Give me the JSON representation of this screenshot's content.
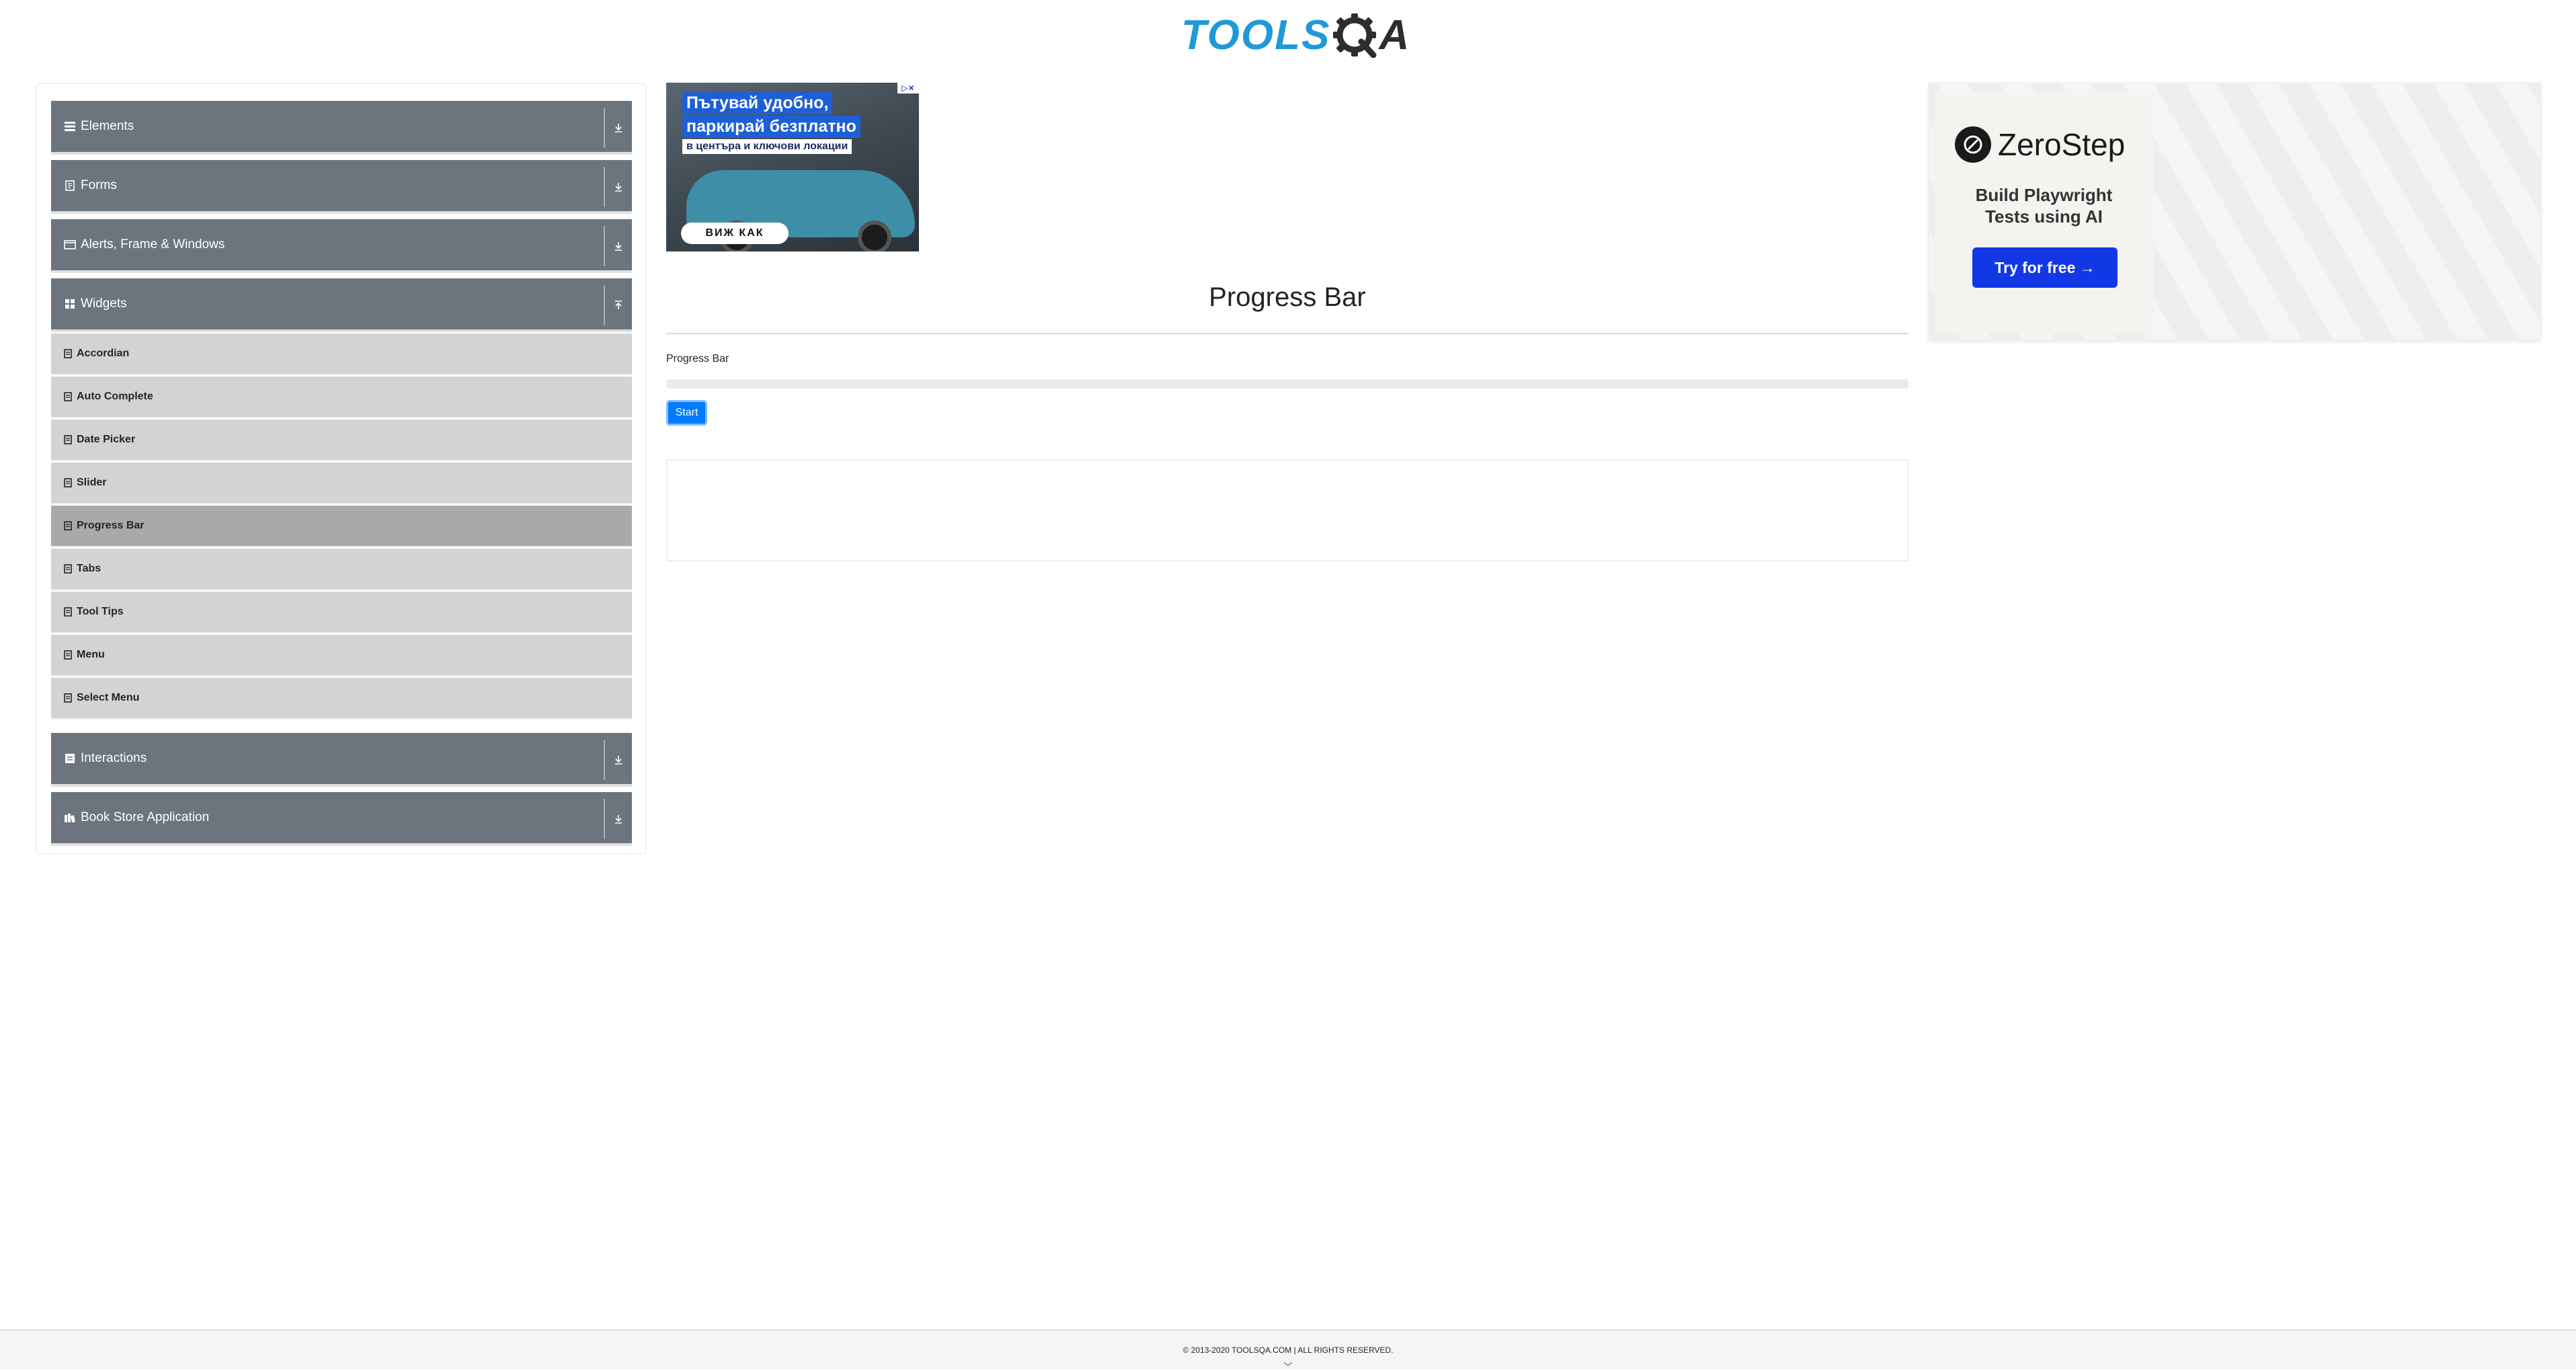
{
  "brand": {
    "logo_text_left": "TOOLS",
    "logo_text_right": "A"
  },
  "sidebar": {
    "groups": [
      {
        "label": "Elements",
        "icon": "menu-icon",
        "expanded": false
      },
      {
        "label": "Forms",
        "icon": "document-icon",
        "expanded": false
      },
      {
        "label": "Alerts, Frame & Windows",
        "icon": "window-icon",
        "expanded": false
      },
      {
        "label": "Widgets",
        "icon": "grid-icon",
        "expanded": true
      },
      {
        "label": "Interactions",
        "icon": "interaction-icon",
        "expanded": false
      },
      {
        "label": "Book Store Application",
        "icon": "books-icon",
        "expanded": false
      }
    ],
    "widget_items": [
      {
        "label": "Accordian",
        "active": false
      },
      {
        "label": "Auto Complete",
        "active": false
      },
      {
        "label": "Date Picker",
        "active": false
      },
      {
        "label": "Slider",
        "active": false
      },
      {
        "label": "Progress Bar",
        "active": true
      },
      {
        "label": "Tabs",
        "active": false
      },
      {
        "label": "Tool Tips",
        "active": false
      },
      {
        "label": "Menu",
        "active": false
      },
      {
        "label": "Select Menu",
        "active": false
      }
    ]
  },
  "ad_left": {
    "line1": "Пътувай удобно,",
    "line2": "паркирай безплатно",
    "line3": "в центъра и ключови локации",
    "cta": "ВИЖ КАК"
  },
  "main": {
    "title": "Progress Bar",
    "progress_label": "Progress Bar",
    "progress_value": 0,
    "start_button": "Start"
  },
  "ad_right": {
    "brand_name": "ZeroStep",
    "tagline_1": "Build Playwright",
    "tagline_2": "Tests using AI",
    "cta": "Try for free →"
  },
  "footer": {
    "copyright": "© 2013-2020 TOOLSQA.COM | ALL RIGHTS RESERVED."
  },
  "colors": {
    "accent": "#007bff",
    "group_bg": "#6c757d",
    "sub_bg": "#d3d3d3",
    "active_bg": "#a9a9a9",
    "logo_blue": "#1f9ad6"
  }
}
